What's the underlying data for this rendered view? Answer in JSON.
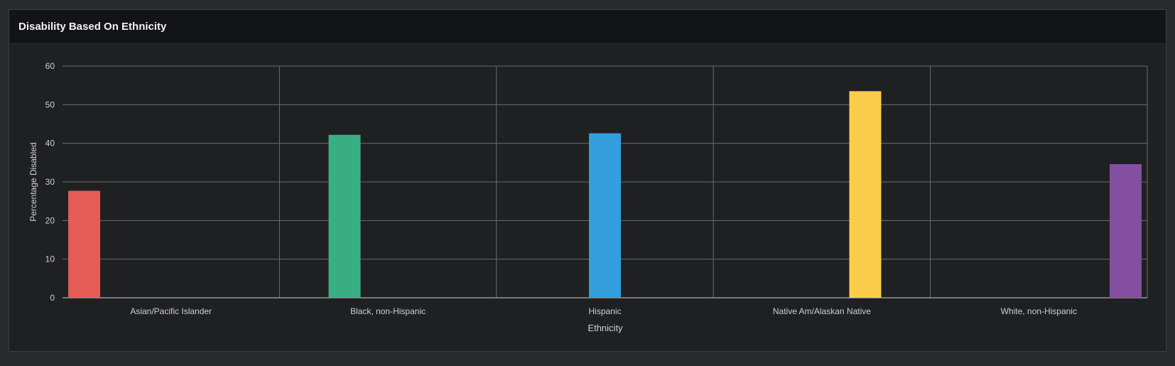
{
  "panel": {
    "title": "Disability Based On Ethnicity"
  },
  "chart_data": {
    "type": "bar",
    "title": "Disability Based On Ethnicity",
    "xlabel": "Ethnicity",
    "ylabel": "Percentage Disabled",
    "ylim": [
      0,
      60
    ],
    "yticks": [
      0,
      10,
      20,
      30,
      40,
      50,
      60
    ],
    "grid": true,
    "categories": [
      "Asian/Pacific Islander",
      "Black, non-Hispanic",
      "Hispanic",
      "Native Am/Alaskan Native",
      "White, non-Hispanic"
    ],
    "values": [
      27.7,
      42.2,
      42.6,
      53.5,
      34.6
    ],
    "colors": [
      "#e85c58",
      "#3aae83",
      "#329fdc",
      "#f9cd4a",
      "#844fa0"
    ],
    "axis_text_color": "#cfcfcf",
    "grid_color": "#6a6b6d"
  }
}
